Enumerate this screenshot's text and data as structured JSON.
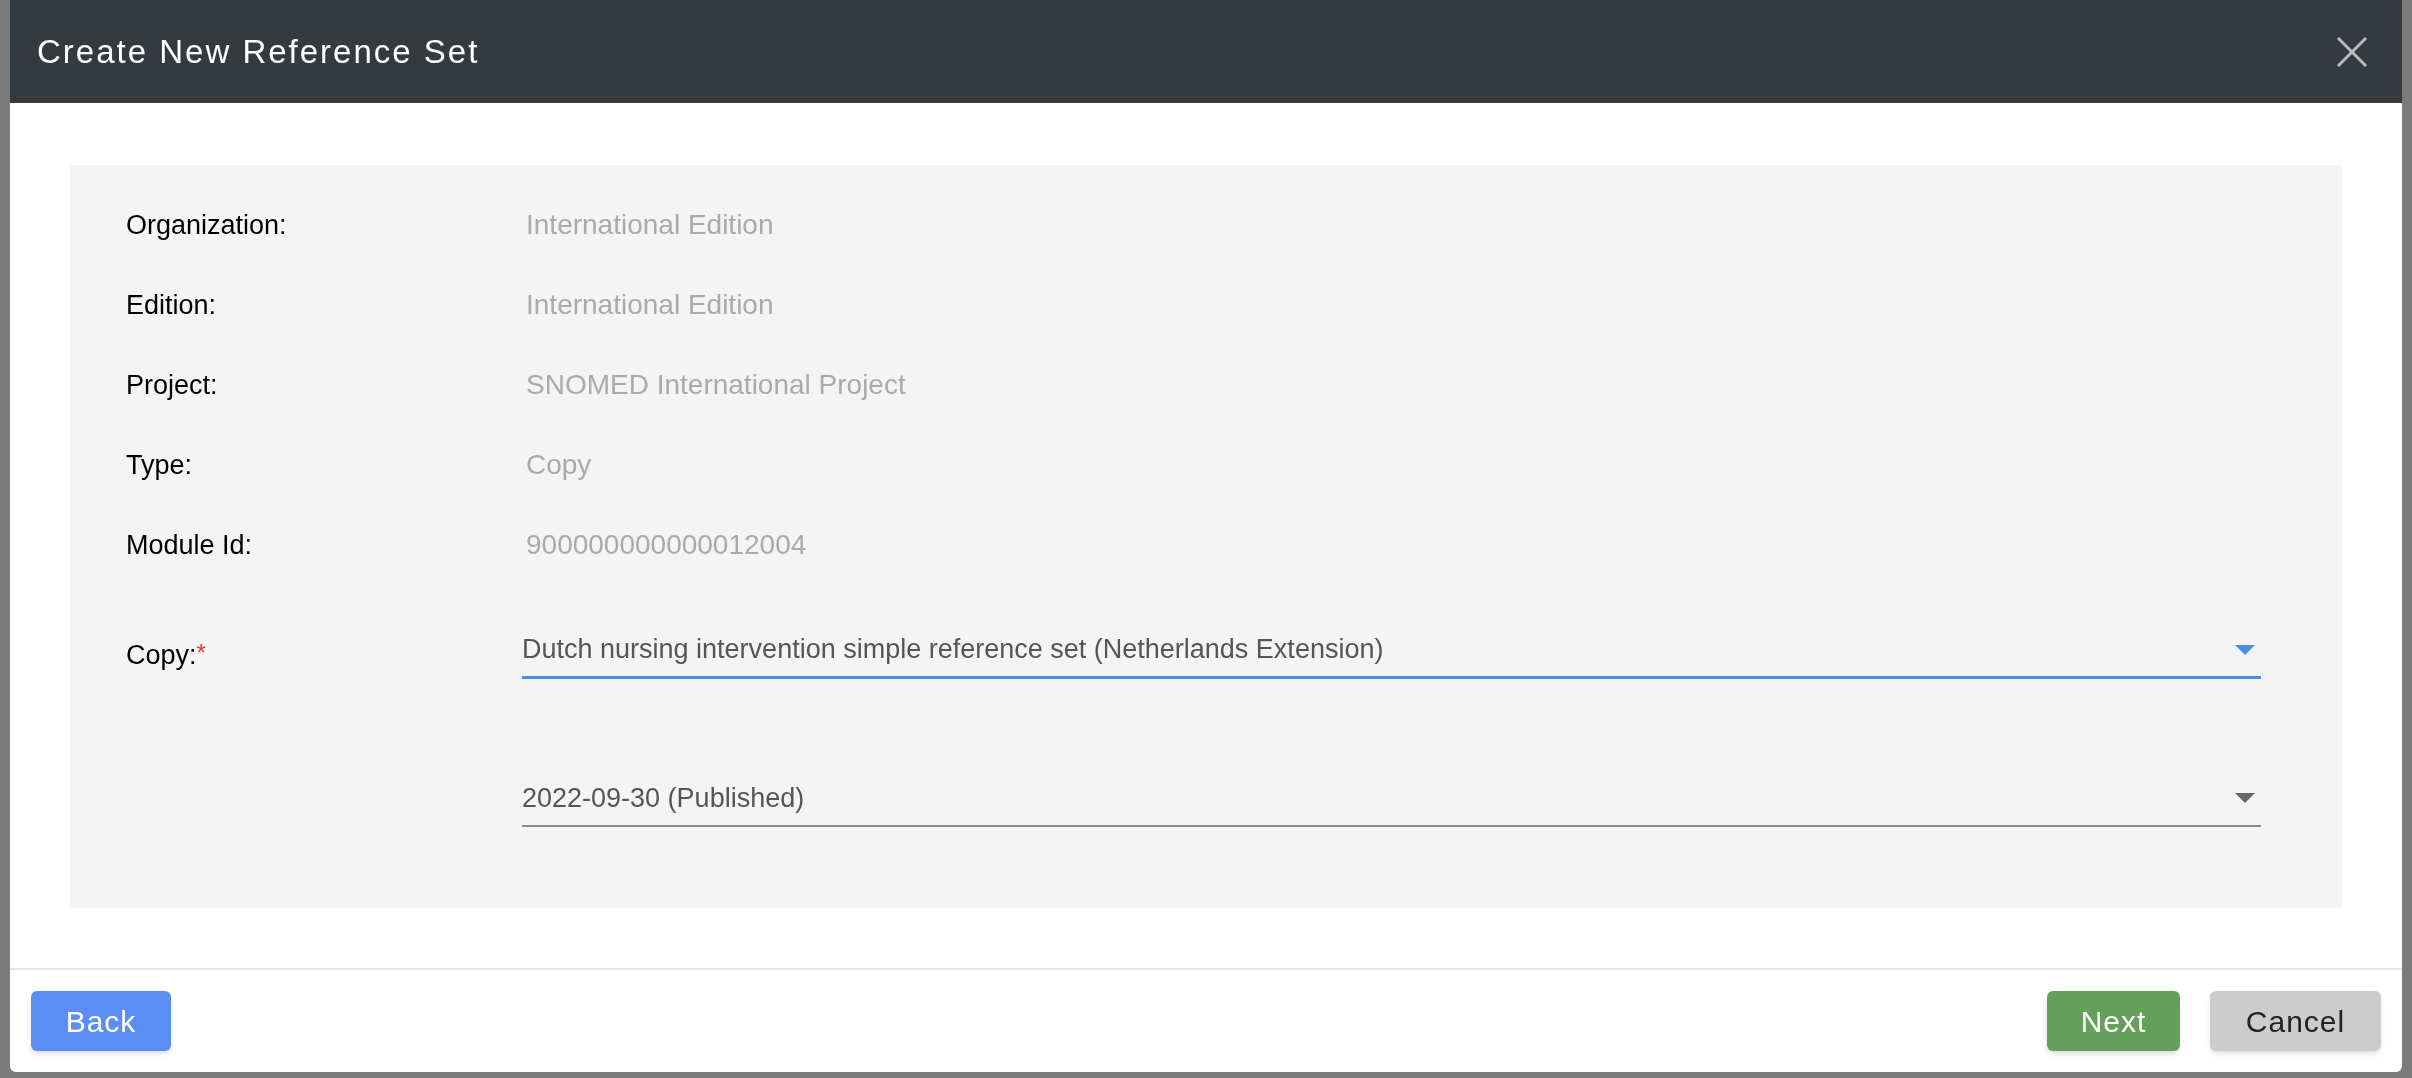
{
  "dialog": {
    "title": "Create New Reference Set"
  },
  "fields": [
    {
      "label": "Organization:",
      "value": "International Edition"
    },
    {
      "label": "Edition:",
      "value": "International Edition"
    },
    {
      "label": "Project:",
      "value": "SNOMED International Project"
    },
    {
      "label": "Type:",
      "value": "Copy"
    },
    {
      "label": "Module Id:",
      "value": "900000000000012004"
    }
  ],
  "copy": {
    "label": "Copy:",
    "required_mark": "*",
    "selects": [
      {
        "value": "Dutch nursing intervention simple reference set (Netherlands Extension)",
        "focused": true
      },
      {
        "value": "2022-09-30 (Published)",
        "focused": false
      }
    ]
  },
  "buttons": [
    {
      "label": "Back",
      "kind": "back"
    },
    {
      "label": "Next",
      "kind": "next"
    },
    {
      "label": "Cancel",
      "kind": "cancel"
    }
  ]
}
